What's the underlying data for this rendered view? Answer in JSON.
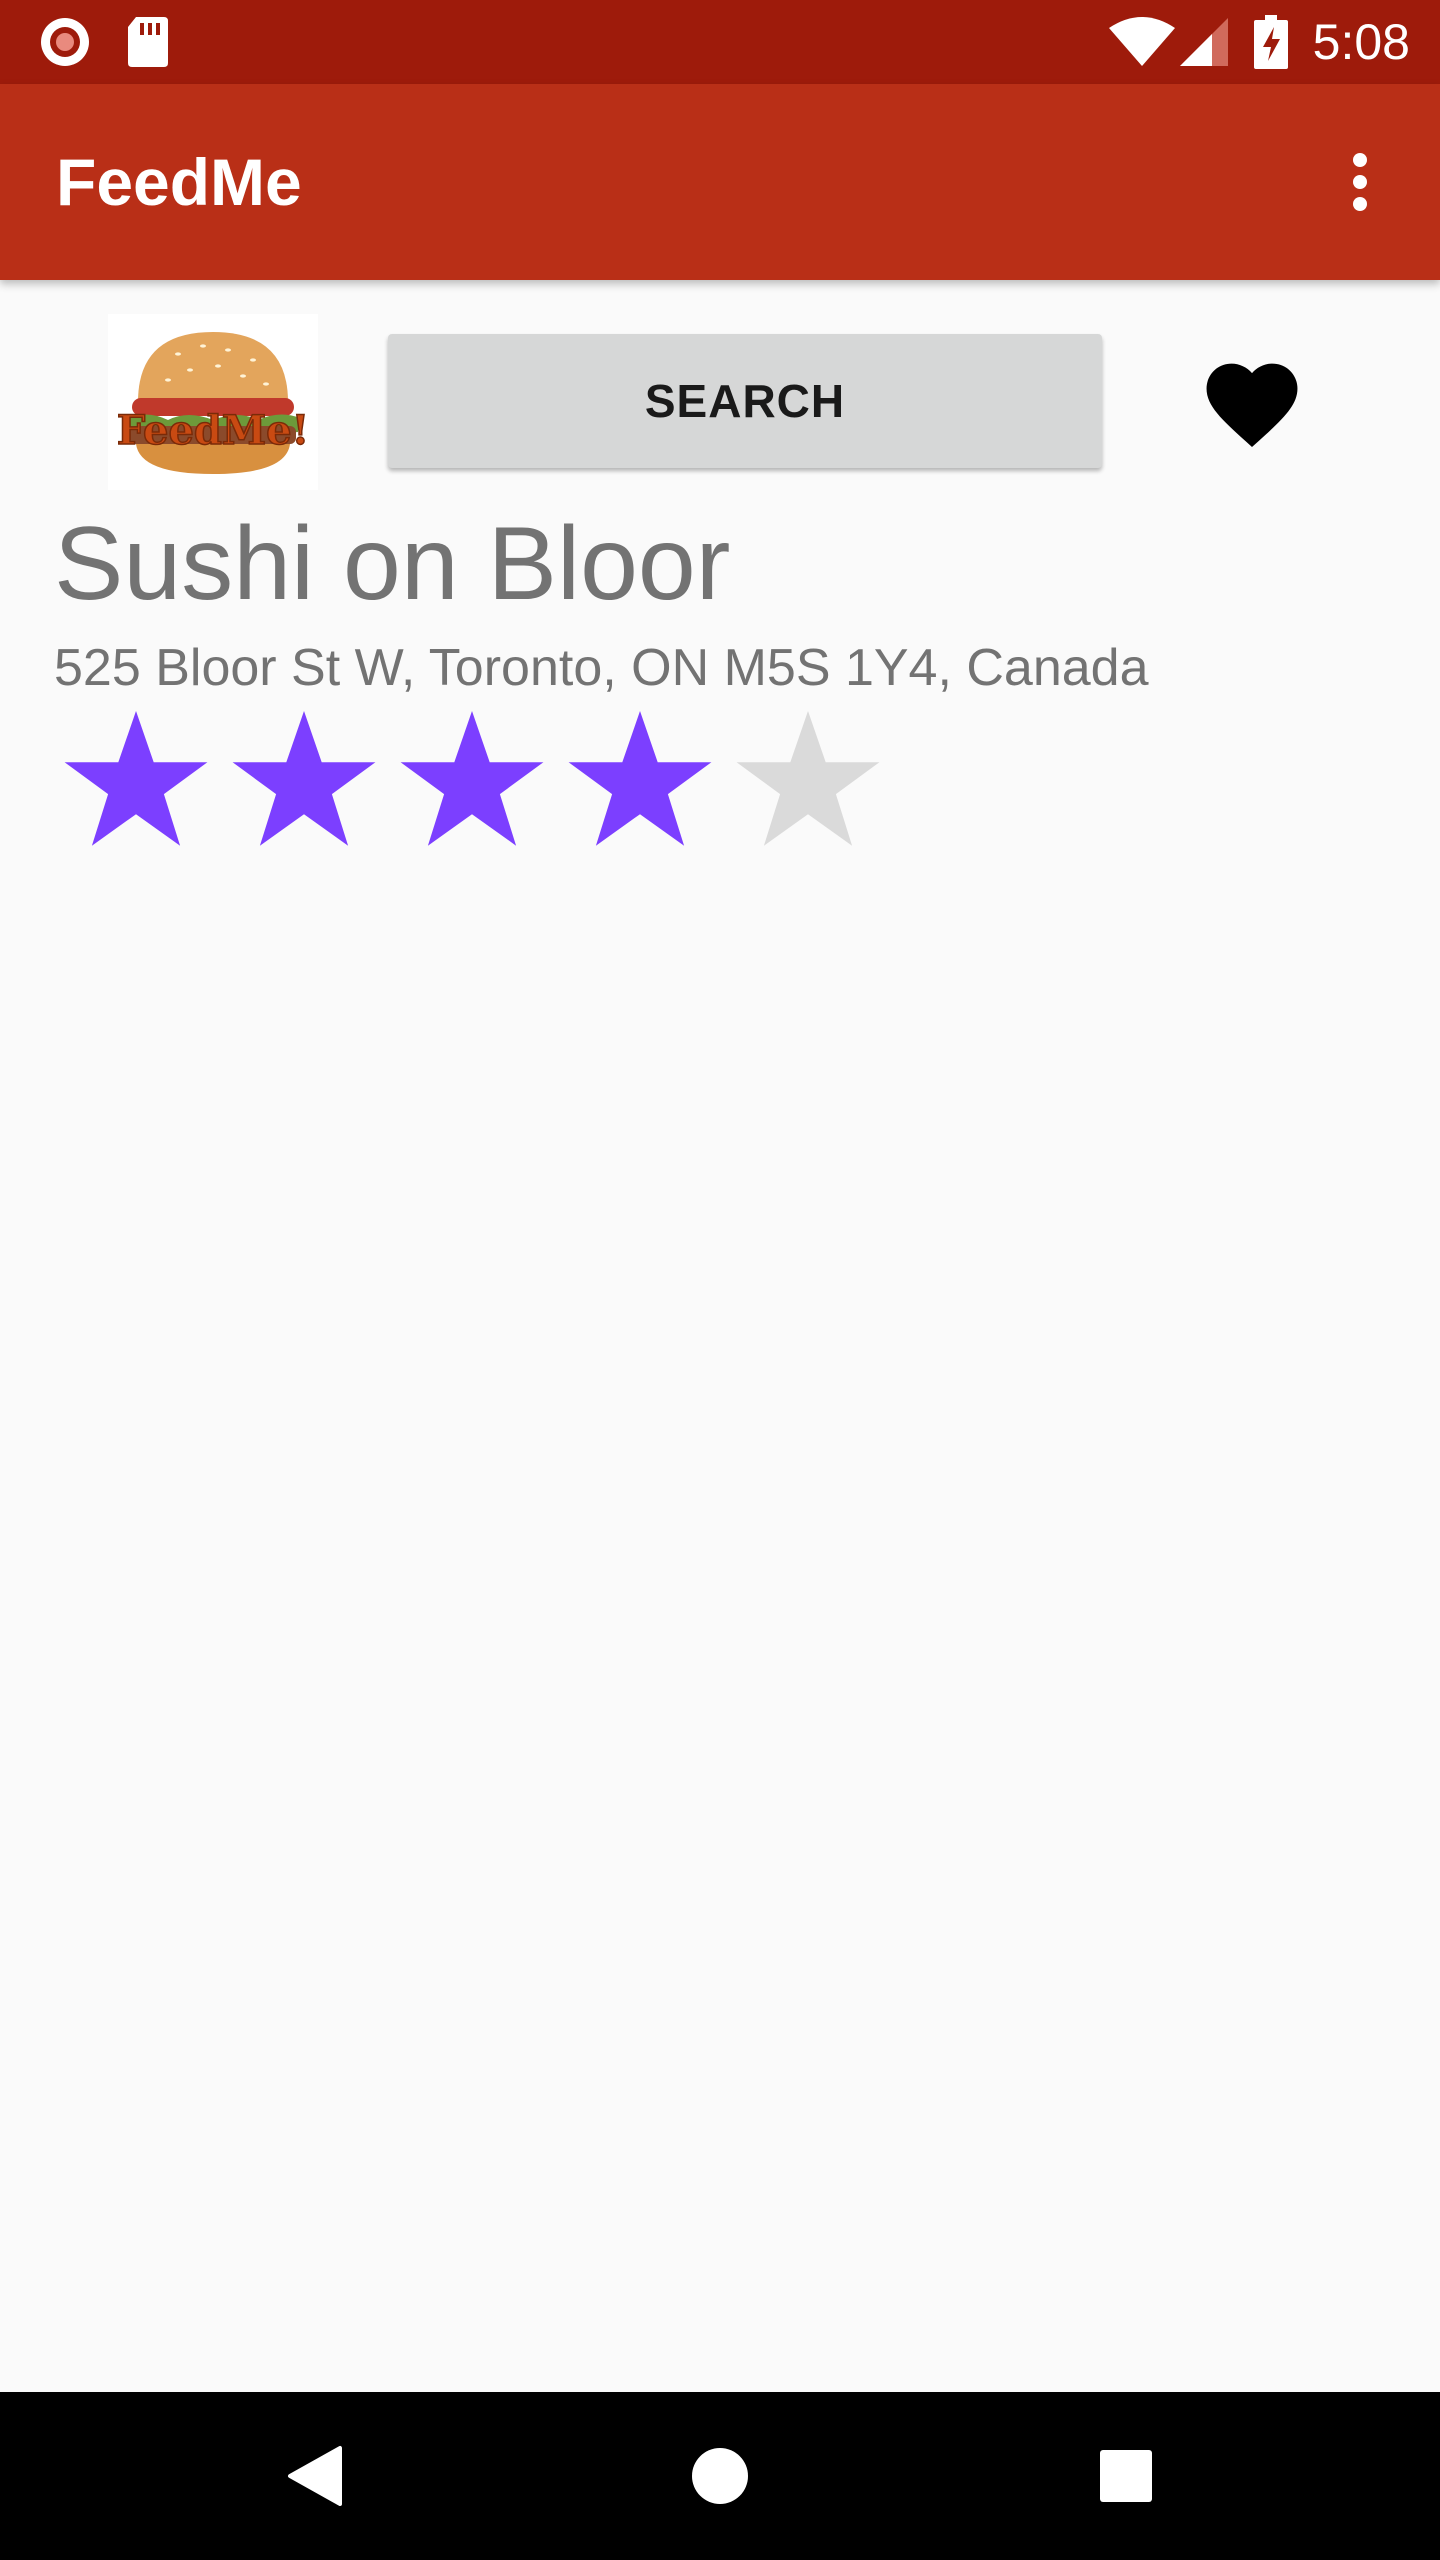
{
  "status_bar": {
    "time": "5:08",
    "icons": [
      "notification-icon",
      "sd-card-icon",
      "wifi-icon",
      "cell-signal-icon",
      "battery-charging-icon"
    ]
  },
  "app_bar": {
    "title": "FeedMe",
    "menu_icon": "more-vert-icon"
  },
  "toolbar": {
    "logo_text": "FeedMe!",
    "search_label": "SEARCH",
    "favorite_icon": "heart-icon"
  },
  "restaurant": {
    "name": "Sushi on Bloor",
    "address": "525 Bloor St W, Toronto, ON M5S 1Y4, Canada",
    "rating": 4,
    "rating_max": 5
  },
  "colors": {
    "status_bar": "#9e1b0b",
    "app_bar": "#b92f17",
    "star_filled": "#7c3fff",
    "star_empty": "#dadada"
  },
  "nav_bar": {
    "icons": [
      "back-icon",
      "home-icon",
      "recents-icon"
    ]
  }
}
